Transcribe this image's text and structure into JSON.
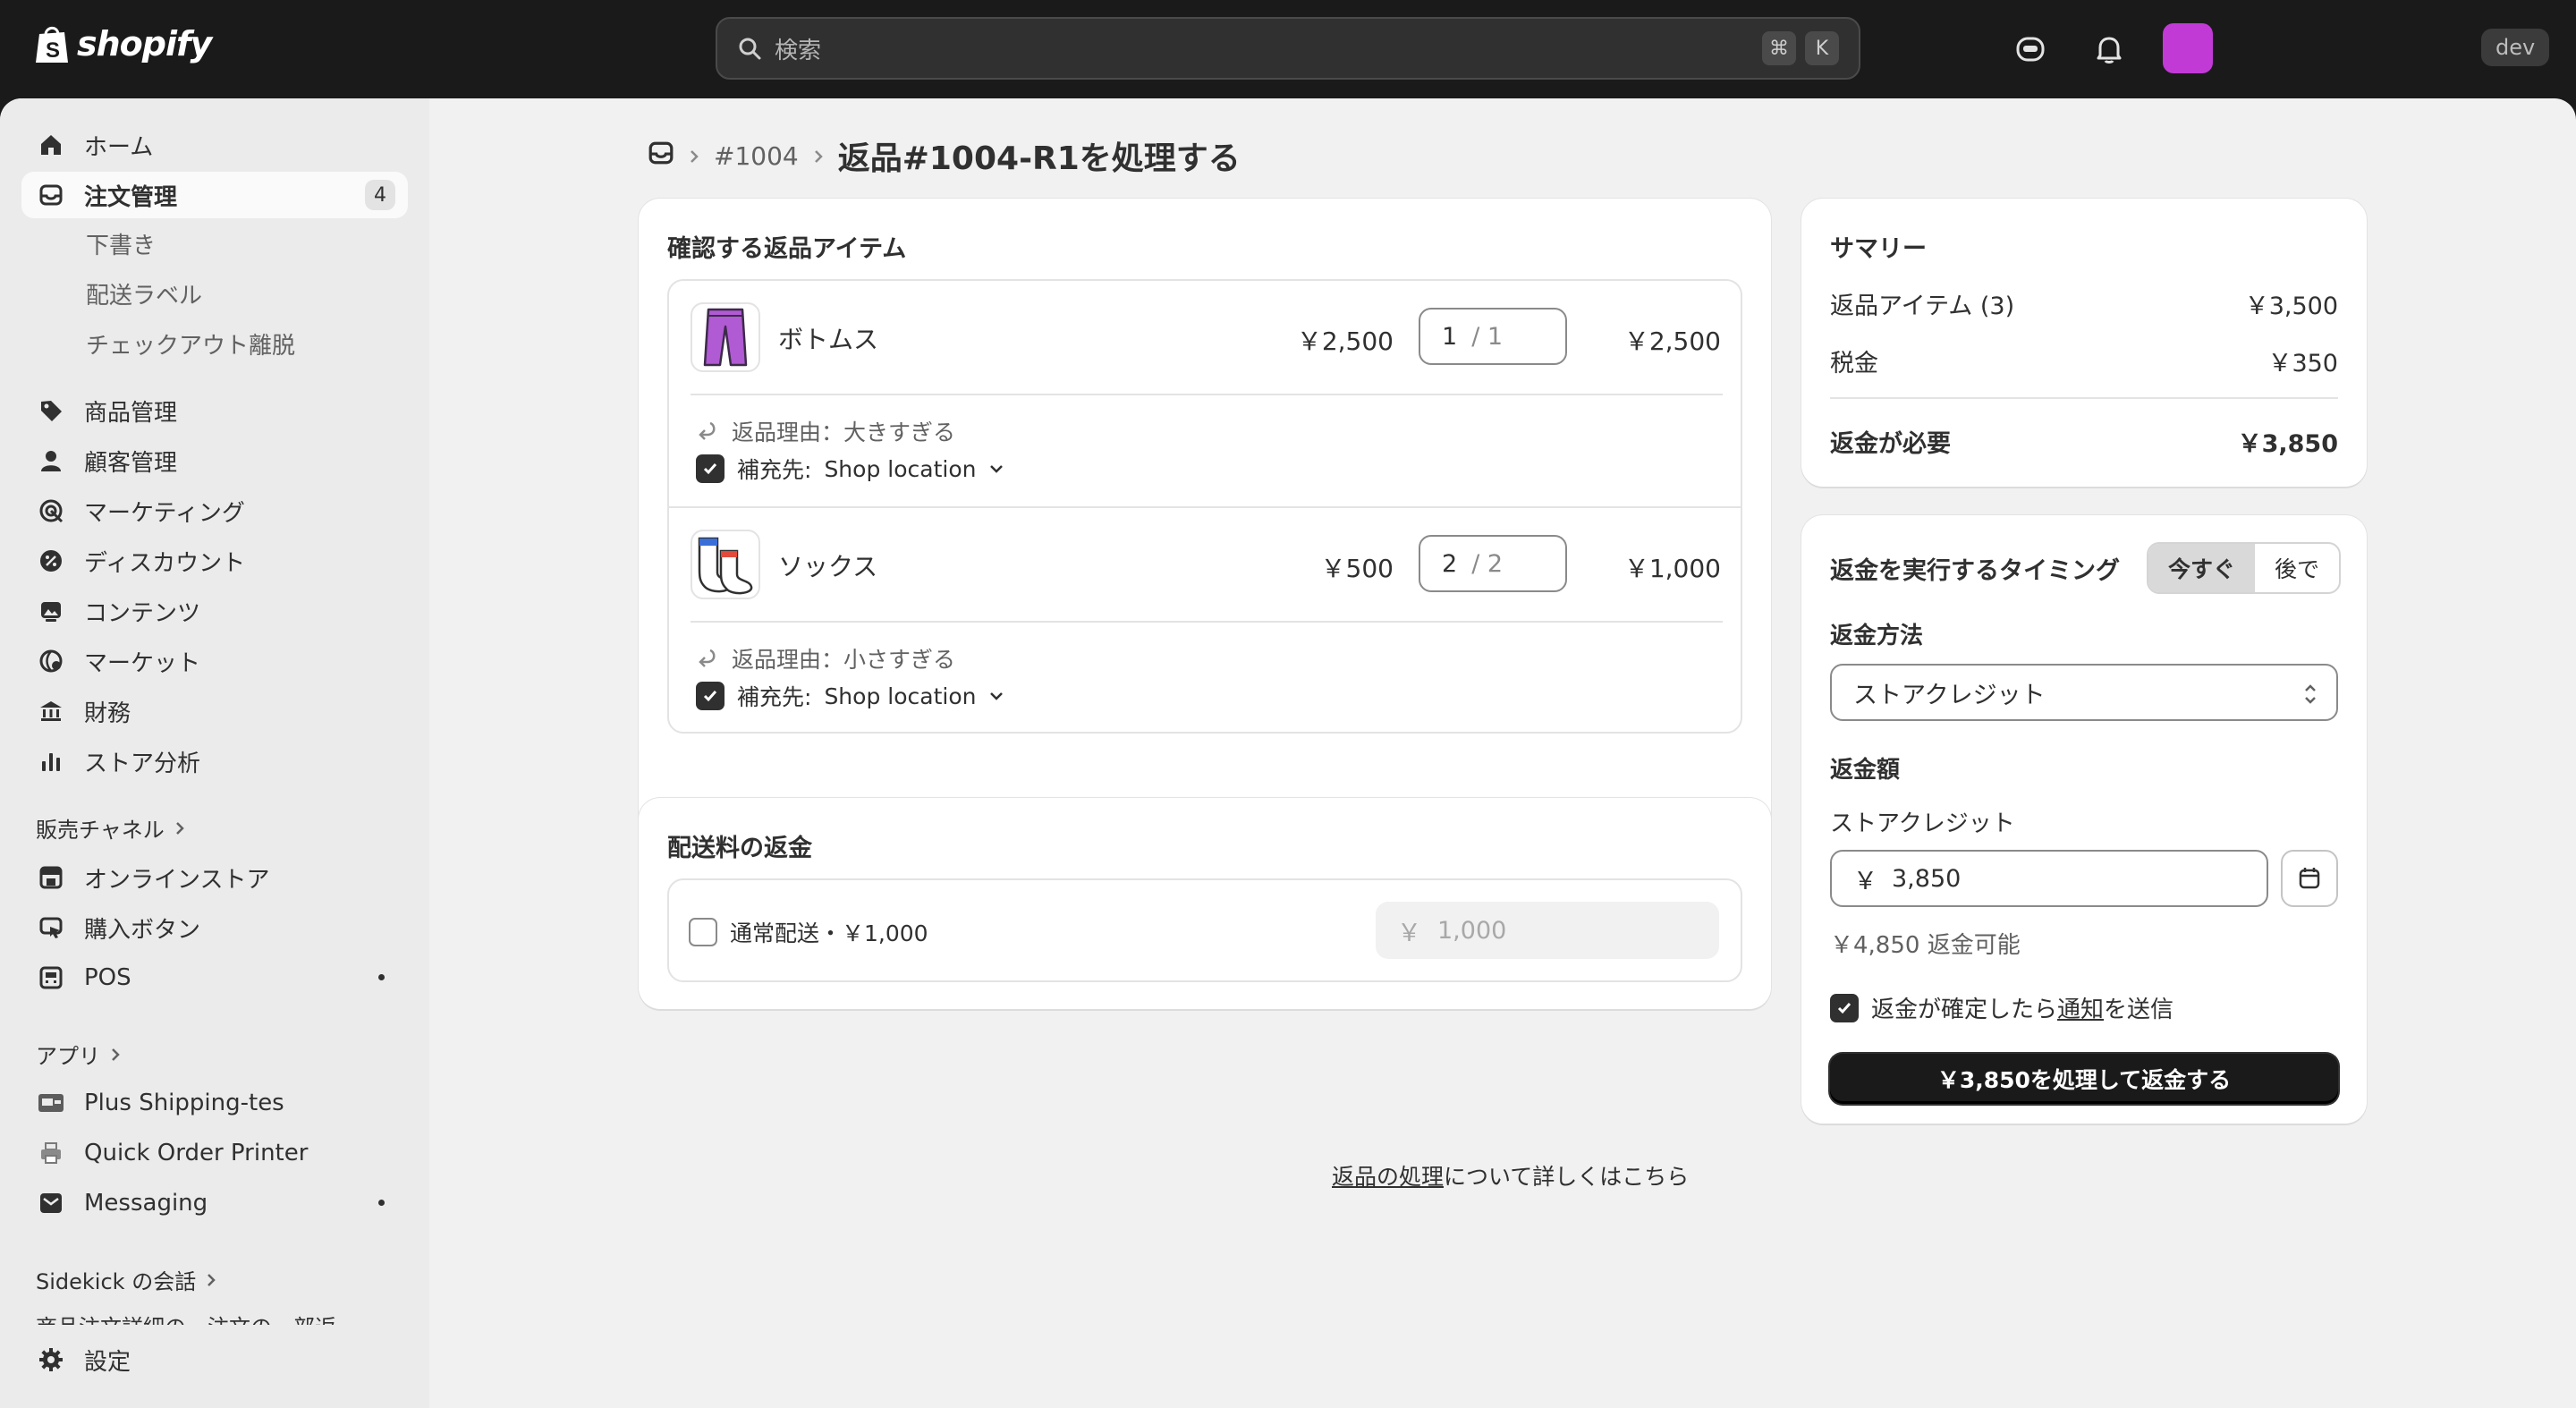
{
  "app": {
    "brand": "shopify",
    "accent": "#c13ad6"
  },
  "search": {
    "placeholder": "検索",
    "kbd_cmd": "⌘",
    "kbd_key": "K"
  },
  "topbar": {
    "env_badge": "dev"
  },
  "sidebar": {
    "items": [
      {
        "label": "ホーム",
        "icon": "home-icon"
      },
      {
        "label": "注文管理",
        "icon": "inbox-icon",
        "badge": "4",
        "active": true
      },
      {
        "label": "商品管理",
        "icon": "tag-icon"
      },
      {
        "label": "顧客管理",
        "icon": "person-icon"
      },
      {
        "label": "マーケティング",
        "icon": "target-icon"
      },
      {
        "label": "ディスカウント",
        "icon": "discount-icon"
      },
      {
        "label": "コンテンツ",
        "icon": "image-icon"
      },
      {
        "label": "マーケット",
        "icon": "globe-icon"
      },
      {
        "label": "財務",
        "icon": "bank-icon"
      },
      {
        "label": "ストア分析",
        "icon": "bar-chart-icon"
      }
    ],
    "order_subitems": [
      "下書き",
      "配送ラベル",
      "チェックアウト離脱"
    ],
    "sales_channels_heading": "販売チャネル",
    "channels": [
      {
        "label": "オンラインストア",
        "icon": "store-icon"
      },
      {
        "label": "購入ボタン",
        "icon": "buy-button-icon"
      },
      {
        "label": "POS",
        "icon": "pos-icon"
      }
    ],
    "apps_heading": "アプリ",
    "apps": [
      {
        "label": "Plus Shipping-tes",
        "icon": "shipping-app-icon"
      },
      {
        "label": "Quick Order Printer",
        "icon": "printer-icon"
      },
      {
        "label": "Messaging",
        "icon": "messaging-icon"
      }
    ],
    "sidekick_heading": "Sidekick の会話",
    "sidekick_preview": "商品注文詳細の、注文の一部返",
    "settings": "設定"
  },
  "breadcrumb": {
    "order": "#1004",
    "title": "返品#1004-R1を処理する"
  },
  "return_items": {
    "title": "確認する返品アイテム",
    "items": [
      {
        "name": "ボトムス",
        "unit_price": "￥2,500",
        "qty": "1",
        "qty_of": "/ 1",
        "total": "￥2,500",
        "reason": "返品理由：大きすぎる",
        "restock_label": "補充先:",
        "restock_location": "Shop location"
      },
      {
        "name": "ソックス",
        "unit_price": "￥500",
        "qty": "2",
        "qty_of": "/ 2",
        "total": "￥1,000",
        "reason": "返品理由：小さすぎる",
        "restock_label": "補充先:",
        "restock_location": "Shop location"
      }
    ]
  },
  "shipping_refund": {
    "title": "配送料の返金",
    "option": "通常配送・￥1,000",
    "currency": "￥",
    "amount_placeholder": "1,000"
  },
  "summary": {
    "title": "サマリー",
    "rows": [
      {
        "label": "返品アイテム (3)",
        "value": "￥3,500"
      },
      {
        "label": "税金",
        "value": "￥350"
      }
    ],
    "total_label": "返金が必要",
    "total_value": "￥3,850"
  },
  "refund": {
    "timing_label": "返金を実行するタイミング",
    "timing_now": "今すぐ",
    "timing_later": "後で",
    "method_label": "返金方法",
    "method_value": "ストアクレジット",
    "amount_label": "返金額",
    "credit_label": "ストアクレジット",
    "currency": "￥",
    "amount_value": "3,850",
    "available": "￥4,850 返金可能",
    "notify_prefix": "返金が確定したら",
    "notify_link": "通知",
    "notify_suffix": "を送信",
    "process_button": "￥3,850を処理して返金する"
  },
  "footer": {
    "link": "返品の処理",
    "text": "について詳しくはこちら"
  }
}
